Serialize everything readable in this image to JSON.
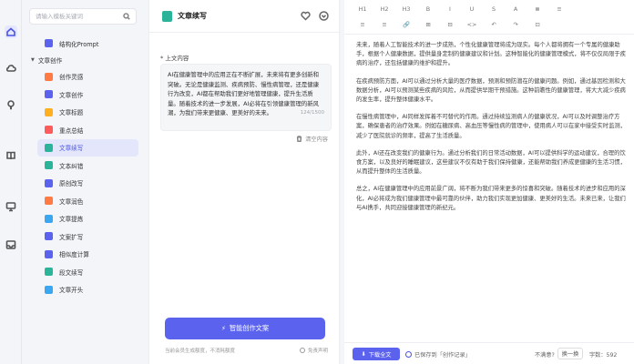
{
  "rail": {
    "icons": [
      "home-icon",
      "cloud-icon",
      "bulb-icon",
      "book-icon",
      "monitor-icon",
      "inbox-icon"
    ]
  },
  "sidebar": {
    "search_placeholder": "请输入模板关键词",
    "top_item": {
      "label": "结构化Prompt",
      "color": "#5b63ee"
    },
    "group_label": "文章创作",
    "items": [
      {
        "label": "创作灵感",
        "color": "#ff7a45"
      },
      {
        "label": "文章创作",
        "color": "#5b63ee"
      },
      {
        "label": "文章标题",
        "color": "#ffb020"
      },
      {
        "label": "重点总结",
        "color": "#ff5b5b"
      },
      {
        "label": "文章续写",
        "color": "#2bb49a"
      },
      {
        "label": "文本纠错",
        "color": "#2bb49a"
      },
      {
        "label": "原创改写",
        "color": "#5b63ee"
      },
      {
        "label": "文章润色",
        "color": "#ff7a45"
      },
      {
        "label": "文章提炼",
        "color": "#3aa7f0"
      },
      {
        "label": "文案扩写",
        "color": "#5b63ee"
      },
      {
        "label": "相似度计算",
        "color": "#5b63ee"
      },
      {
        "label": "段文续写",
        "color": "#2bb49a"
      },
      {
        "label": "文章开头",
        "color": "#3aa7f0"
      }
    ],
    "active_index": 4
  },
  "middle": {
    "title": "文章续写",
    "section_label": "* 上文内容",
    "input_text": "AI在健康管理中的应用正在不断扩展，未来将有更多创新和突破。无论是健康监测、疾病预防、慢性病管理，还是健康行为改变，AI都在帮助我们更好地管理健康，提升生活质量。随着技术的进一步发展，AI必将在引领健康管理的新风潮，为我们带来更健康、更美好的未来。",
    "char_count": "124/1500",
    "clear_label": "清空内容",
    "generate_label": "智能创作文案",
    "footer_left": "当前会员生成额度，不消耗额度",
    "footer_right": "免责声明"
  },
  "editor": {
    "toolbar": [
      "H1",
      "H2",
      "H3",
      "B",
      "I",
      "U",
      "S",
      "A",
      "≣",
      "≡",
      "≡",
      "≡",
      "🔗",
      "⊞",
      "⊟",
      "<>",
      "↶",
      "↷",
      "⊡"
    ],
    "paragraphs": [
      "未来，随着人工智能技术的进一步成熟，个性化健康管理将成为现实。每个人都将拥有一个专属的健康助手，根据个人健康数据，提供量身定制的健康建议和计划。这种智能化的健康管理模式，将不仅仅局限于疾病的治疗，还包括健康的维护和提升。",
      "在疾病预防方面，AI可以通过分析大量的医疗数据，预测和预防潜在的健康问题。例如，通过基因检测和大数据分析，AI可以预测某些疾病的风险，从而提供早期干预措施。这种前瞻性的健康管理，将大大减少疾病的发生率，提升整体健康水平。",
      "在慢性病管理中，AI同样发挥着不可替代的作用。通过持续监测病人的健康状况，AI可以及时调整治疗方案，确保患者的治疗效果。例如在糖尿病、高血压等慢性病的管理中，使用病人可以在家中接受实时监测，减少了医院就诊的频率，提高了生活质量。",
      "此外，AI还在改变我们的健康行为。通过分析我们的日常活动数据，AI可以提供科学的运动建议，合理的饮食方案，以及良好的睡眠建议，这些建议不仅有助于我们保持健康，还能帮助我们养成更健康的生活习惯，从而提升整体的生活质量。",
      "总之，AI在健康管理中的应用前景广阔，将不断为我们带来更多的惊喜和突破。随着技术的进步和应用的深化，AI必将成为我们健康管理中最可靠的伙伴，助力我们实现更加健康、更美好的生活。未来已来，让我们与AI携手，共同迎接健康管理的新纪元。"
    ],
    "download_label": "下载全文",
    "save_label": "已保存到「创作记录」",
    "unsatisfied_label": "不满意?",
    "change_label": "换一换",
    "word_count_label": "字数：592"
  }
}
